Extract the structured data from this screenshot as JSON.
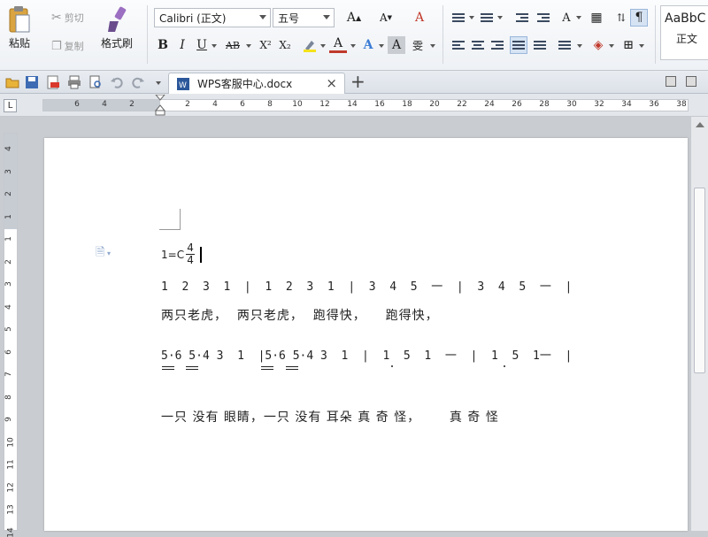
{
  "ribbon": {
    "paste_label": "粘贴",
    "cut_label": "剪切",
    "copy_label": "复制",
    "format_painter_label": "格式刷",
    "font_name": "Calibri (正文)",
    "font_size": "五号",
    "bold": "B",
    "italic": "I",
    "underline": "U",
    "strike": "AB",
    "superscript": "X²",
    "subscript": "X₂",
    "font_color": "A",
    "char_shading": "A",
    "phonetic": "雯",
    "style_preview": "AaBbC",
    "style_name": "正文"
  },
  "tabs": {
    "doc_name": "WPS客服中心.docx",
    "new_tab": "+"
  },
  "ruler": {
    "left_numbers": [
      "6",
      "4",
      "2"
    ],
    "right_numbers": [
      "2",
      "4",
      "6",
      "8",
      "10",
      "12",
      "14",
      "16",
      "18",
      "20",
      "22",
      "24",
      "26",
      "28",
      "30",
      "32",
      "34",
      "36",
      "38"
    ],
    "vertical_numbers": [
      "4",
      "3",
      "2",
      "1",
      "1",
      "2",
      "3",
      "4",
      "5",
      "6",
      "7",
      "8",
      "9",
      "10",
      "11",
      "12",
      "13",
      "14"
    ]
  },
  "document": {
    "key_prefix": "1=C",
    "time_top": "4",
    "time_bottom": "4",
    "line1": "1  2  3  1  |  1  2  3  1  |  3  4  5  一  |  3  4  5  一  |",
    "lyrics1": "两只老虎，  两只老虎，  跑得快，    跑得快，",
    "line2": "5·6 5·4 3  1  |5·6 5·4 3  1  |  1  5  1  一  |  1  5  1一  |",
    "lyrics2": "一只 没有 眼睛，一只 没有 耳朵 真 奇 怪，      真 奇 怪"
  }
}
